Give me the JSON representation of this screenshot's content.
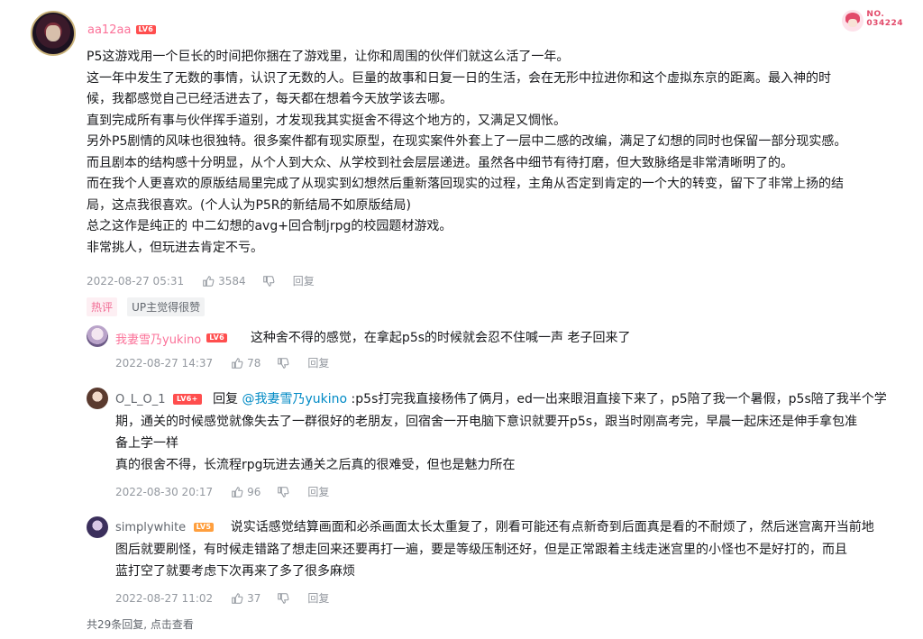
{
  "main": {
    "username": "aa12aa",
    "level": "LV6",
    "badge_no_label": "NO.",
    "badge_no_value": "034224",
    "lines": [
      "P5这游戏用一个巨长的时间把你捆在了游戏里，让你和周围的伙伴们就这么活了一年。",
      "这一年中发生了无数的事情，认识了无数的人。巨量的故事和日复一日的生活，会在无形中拉进你和这个虚拟东京的距离。最入神的时",
      "候，我都感觉自己已经活进去了，每天都在想着今天放学该去哪。",
      "直到完成所有事与伙伴挥手道别，才发现我其实挺舍不得这个地方的，又满足又惆怅。",
      "另外P5剧情的风味也很独特。很多案件都有现实原型，在现实案件外套上了一层中二感的改编，满足了幻想的同时也保留一部分现实感。",
      "而且剧本的结构感十分明显，从个人到大众、从学校到社会层层递进。虽然各中细节有待打磨，但大致脉络是非常清晰明了的。",
      "而在我个人更喜欢的原版结局里完成了从现实到幻想然后重新落回现实的过程，主角从否定到肯定的一个大的转变，留下了非常上扬的结",
      "局，这点我很喜欢。(个人认为P5R的新结局不如原版结局)",
      "总之这作是纯正的 中二幻想的avg+回合制jrpg的校园题材游戏。",
      "非常挑人，但玩进去肯定不亏。"
    ],
    "time": "2022-08-27 05:31",
    "likes": "3584",
    "reply_label": "回复",
    "tag_hot": "热评",
    "tag_up": "UP主觉得很赞"
  },
  "replies": [
    {
      "username": "我妻雪乃yukino",
      "level": "LV6",
      "text": "这种舍不得的感觉，在拿起p5s的时候就会忍不住喊一声 老子回来了",
      "time": "2022-08-27 14:37",
      "likes": "78",
      "reply_label": "回复"
    },
    {
      "username": "O_L_O_1",
      "level": "LV6+",
      "reply_prefix": "回复 ",
      "mention": "@我妻雪乃yukino",
      "line1": " :p5s打完我直接杨伟了俩月，ed一出来眼泪直接下来了，p5陪了我一个暑假，p5s陪了我半个学",
      "line2": "期，通关的时候感觉就像失去了一群很好的老朋友，回宿舍一开电脑下意识就要开p5s，跟当时刚高考完，早晨一起床还是伸手拿包准",
      "line3": "备上学一样",
      "line4": "真的很舍不得，长流程rpg玩进去通关之后真的很难受，但也是魅力所在",
      "time": "2022-08-30 20:17",
      "likes": "96",
      "reply_label": "回复"
    },
    {
      "username": "simplywhite",
      "level": "LV5",
      "line1": "说实话感觉结算画面和必杀画面太长太重复了，刚看可能还有点新奇到后面真是看的不耐烦了，然后迷宫离开当前地",
      "line2": "图后就要刷怪，有时候走错路了想走回来还要再打一遍，要是等级压制还好，但是正常跟着主线走迷宫里的小怪也不是好打的，而且",
      "line3": "蓝打空了就要考虑下次再来了多了很多麻烦",
      "time": "2022-08-27 11:02",
      "likes": "37",
      "reply_label": "回复"
    }
  ],
  "footer": {
    "more_text": "共29条回复, 点击查看"
  }
}
